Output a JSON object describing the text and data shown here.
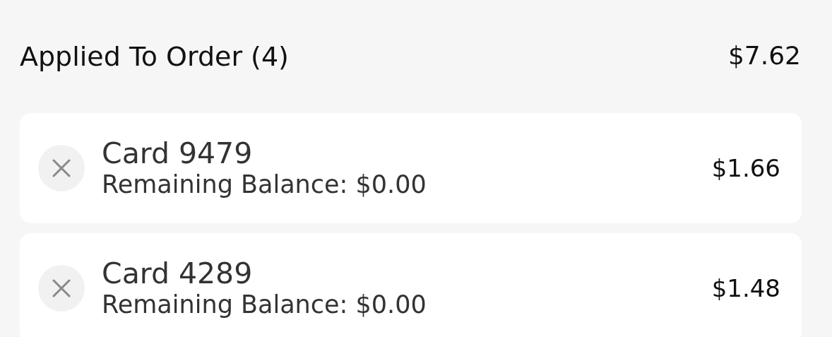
{
  "header": {
    "title": "Applied To Order (4)",
    "total": "$7.62"
  },
  "cards": [
    {
      "name": "Card 9479",
      "balance": "Remaining Balance: $0.00",
      "amount": "$1.66"
    },
    {
      "name": "Card 4289",
      "balance": "Remaining Balance: $0.00",
      "amount": "$1.48"
    }
  ]
}
